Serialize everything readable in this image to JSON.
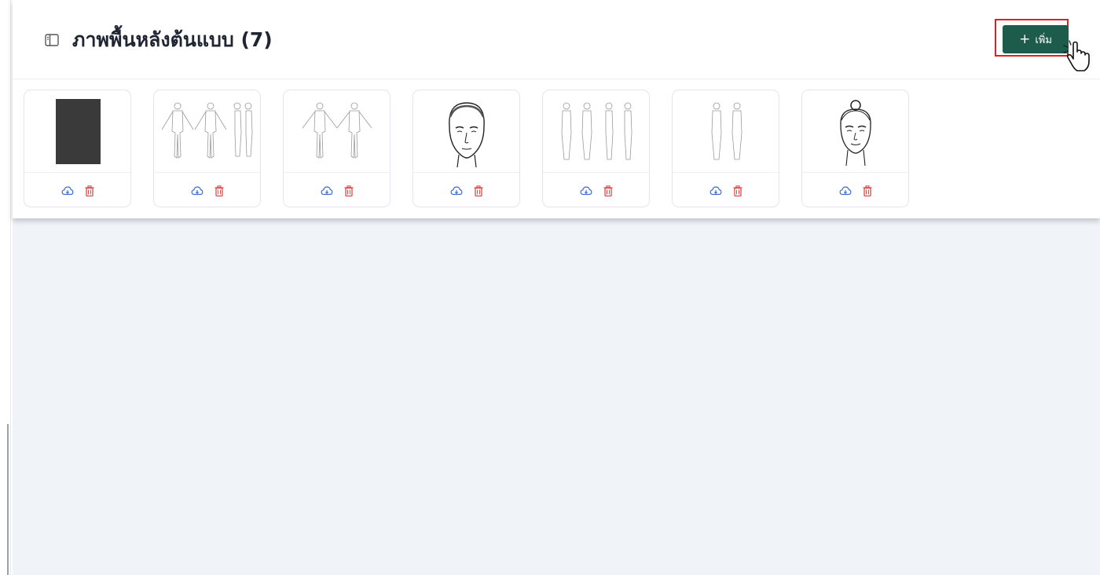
{
  "header": {
    "title": "ภาพพื้นหลังต้นแบบ (7)",
    "title_icon": "panel-layout-icon"
  },
  "toolbar": {
    "add_label": "เพิ่ม",
    "add_icon": "plus-icon"
  },
  "colors": {
    "primary": "#1d5c4a",
    "highlight": "#e02020",
    "download": "#3b6fd6",
    "delete": "#e04848"
  },
  "templates": [
    {
      "name": "dark-rectangle",
      "actions": [
        "download-cloud-icon",
        "trash-icon"
      ]
    },
    {
      "name": "body-outline-front-back-side",
      "actions": [
        "download-cloud-icon",
        "trash-icon"
      ]
    },
    {
      "name": "body-outline-front-back",
      "actions": [
        "download-cloud-icon",
        "trash-icon"
      ]
    },
    {
      "name": "male-face-outline",
      "actions": [
        "download-cloud-icon",
        "trash-icon"
      ]
    },
    {
      "name": "female-body-four-views",
      "actions": [
        "download-cloud-icon",
        "trash-icon"
      ]
    },
    {
      "name": "female-body-two-views",
      "actions": [
        "download-cloud-icon",
        "trash-icon"
      ]
    },
    {
      "name": "female-face-outline",
      "actions": [
        "download-cloud-icon",
        "trash-icon"
      ]
    }
  ]
}
